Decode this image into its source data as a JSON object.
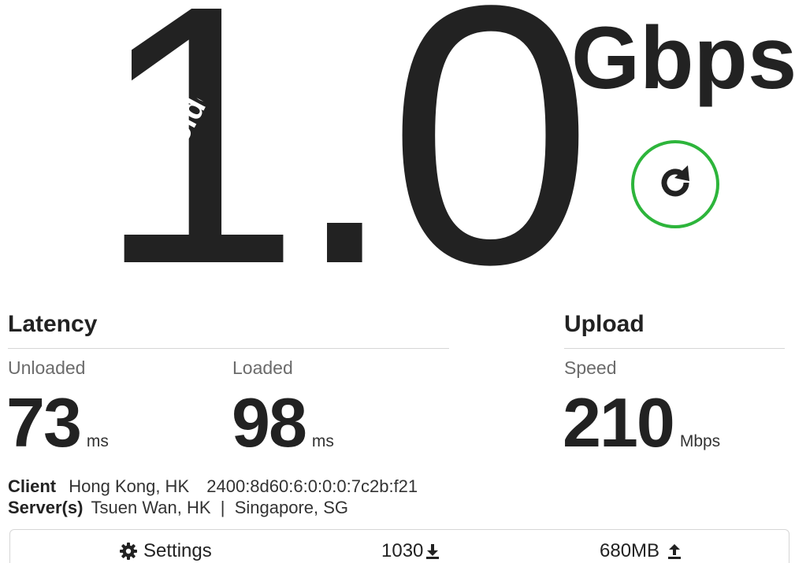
{
  "result": {
    "speed_value": "1.0",
    "speed_unit": "Gbps",
    "watermark": "elde"
  },
  "icons": {
    "restart": "restart-icon",
    "settings": "gear-icon",
    "download": "download-arrow-icon",
    "upload": "upload-arrow-icon"
  },
  "colors": {
    "accent": "#2db53b",
    "text": "#222222",
    "muted": "#6b6b6b"
  },
  "latency": {
    "title": "Latency",
    "unloaded_label": "Unloaded",
    "unloaded_value": "73",
    "unloaded_unit": "ms",
    "loaded_label": "Loaded",
    "loaded_value": "98",
    "loaded_unit": "ms"
  },
  "upload": {
    "title": "Upload",
    "speed_label": "Speed",
    "speed_value": "210",
    "speed_unit": "Mbps"
  },
  "info": {
    "client_label": "Client",
    "client_location": "Hong Kong, HK",
    "client_ip": "2400:8d60:6:0:0:0:7c2b:f21",
    "servers_label": "Server(s)",
    "servers_value": "Tsuen Wan, HK  |  Singapore, SG"
  },
  "footer": {
    "settings_label": "Settings",
    "download_value": "1030",
    "upload_value": "680MB"
  }
}
